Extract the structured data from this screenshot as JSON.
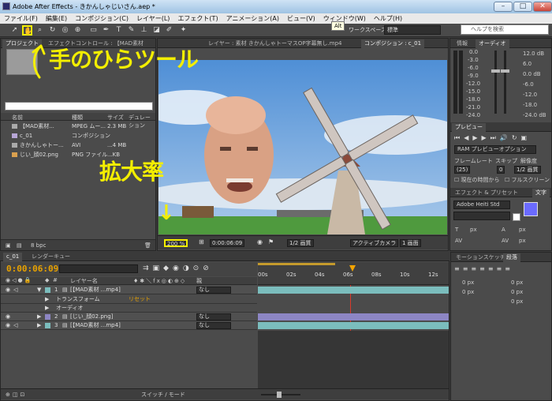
{
  "window": {
    "title": "Adobe After Effects - きかんしゃじいさん.aep *",
    "min": "–",
    "max": "□",
    "close": "✕"
  },
  "menu": [
    "ファイル(F)",
    "編集(E)",
    "コンポジション(C)",
    "レイヤー(L)",
    "エフェクト(T)",
    "アニメーション(A)",
    "ビュー(V)",
    "ウィンドウ(W)",
    "ヘルプ(H)"
  ],
  "toolbar": {
    "tooltip": "Alt",
    "workspace_label": "ワークスペース :",
    "workspace_value": "標準",
    "help_placeholder": "ヘルプを検索"
  },
  "annotations": {
    "hand_tool": "手のひらツール",
    "zoom": "拡大率",
    "arrow": "↓"
  },
  "project": {
    "tab": "プロジェクト",
    "effects_tab": "エフェクトコントロール : 【MAD素材",
    "columns": {
      "name": "名前",
      "type": "種類",
      "size": "サイズ",
      "duration": "デュレーション"
    },
    "items": [
      {
        "name": "【MAD素材...",
        "type": "MPEG ムー...",
        "size": "2.3 MB",
        "color": "#c9c9c9"
      },
      {
        "name": "c_01",
        "type": "コンポジション",
        "size": "",
        "color": "#b7a6d6"
      },
      {
        "name": "きかんしゃトー...",
        "type": "AVI",
        "size": "...4 MB",
        "color": "#c9c9c9"
      },
      {
        "name": "じい_顔02.png",
        "type": "PNG ファイル",
        "size": "...KB",
        "color": "#d9a04f"
      }
    ],
    "bpc": "8 bpc"
  },
  "comp": {
    "tab_layer": "レイヤー : 素材 きかんしゃトーマスOP字幕無し.mp4",
    "tab_comp": "コンポジション : c_01",
    "zoom": "200 %",
    "timecode": "0:00:06:09",
    "resolution": "1/2 画質",
    "camera": "アクティブカメラ",
    "views": "1 画面"
  },
  "info": {
    "tab_info": "情報",
    "tab_audio": "オーディオ",
    "left_scale": [
      "0.0",
      "-3.0",
      "-6.0",
      "-9.0",
      "-12.0",
      "-15.0",
      "-18.0",
      "-21.0",
      "-24.0"
    ],
    "right_scale": [
      "12.0 dB",
      "6.0",
      "0.0 dB",
      "-6.0",
      "-12.0",
      "-18.0",
      "-24.0 dB"
    ]
  },
  "preview": {
    "tab": "プレビュー",
    "ram": "RAM プレビューオプション",
    "framerate_label": "フレームレート",
    "skip_label": "スキップ",
    "resolution_label": "解像度",
    "framerate": "(25)",
    "skip": "0",
    "resolution": "1/2 画質",
    "from_current": "現在の時間から",
    "fullscreen": "フルスクリーン"
  },
  "effects_presets": {
    "tab": "エフェクト & プリセット",
    "tab2": "文字",
    "font": "Adobe Heiti Std",
    "size": "px",
    "leading": "px",
    "tracking": "px"
  },
  "paragraph": {
    "tab1": "モーションスケッチ",
    "tab2": "段落",
    "vals": [
      "0 px",
      "0 px",
      "0 px",
      "0 px",
      "0 px"
    ]
  },
  "timeline": {
    "tab_comp": "c_01",
    "tab_render": "レンダーキュー",
    "timecode": "0:00:06:09",
    "columns": {
      "name": "レイヤー名",
      "parent": "親"
    },
    "ticks": [
      "00s",
      "02s",
      "04s",
      "06s",
      "08s",
      "10s",
      "12s"
    ],
    "layers": [
      {
        "num": "1",
        "name": "[【MAD素材 ...mp4]",
        "parent": "なし",
        "bar": "#7bbdbd"
      },
      {
        "sub": "トランスフォーム",
        "reset": "リセット"
      },
      {
        "sub": "オーディオ"
      },
      {
        "num": "2",
        "name": "[じい_顔02.png]",
        "parent": "なし",
        "bar": "#8d86c4"
      },
      {
        "num": "3",
        "name": "[【MAD素材 ...mp4]",
        "parent": "なし",
        "bar": "#7bbdbd"
      }
    ],
    "switch_mode": "スイッチ / モード"
  }
}
